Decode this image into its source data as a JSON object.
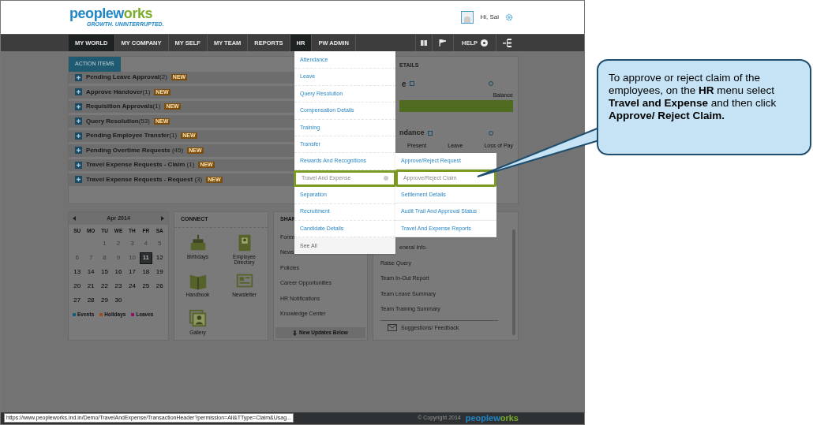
{
  "header": {
    "logo": "peopleworks",
    "tagline": "GROWTH. UNINTERRUPTED.",
    "greeting": "Hi, Sai"
  },
  "nav": {
    "items": [
      {
        "label": "MY WORLD",
        "selected": true
      },
      {
        "label": "MY COMPANY",
        "selected": false
      },
      {
        "label": "MY SELF",
        "selected": false
      },
      {
        "label": "MY TEAM",
        "selected": false
      },
      {
        "label": "REPORTS",
        "selected": false
      },
      {
        "label": "HR",
        "selected": true
      },
      {
        "label": "PW ADMIN",
        "selected": false
      }
    ],
    "help": "HELP"
  },
  "action_items": {
    "tab": "ACTION ITEMS",
    "items": [
      {
        "label": "Pending Leave Approval",
        "count": "(2)",
        "badge": "NEW"
      },
      {
        "label": "Approve Handover",
        "count": "(1)",
        "badge": "NEW"
      },
      {
        "label": "Requisition Approvals",
        "count": "(1)",
        "badge": "NEW"
      },
      {
        "label": "Query Resolution",
        "count": "(53)",
        "badge": "NEW"
      },
      {
        "label": "Pending Employee Transfer",
        "count": "(1)",
        "badge": "NEW"
      },
      {
        "label": "Pending Overtime Requests",
        "count": " (45)",
        "badge": "NEW"
      },
      {
        "label": "Travel Expense Requests - Claim",
        "count": " (1)",
        "badge": "NEW"
      },
      {
        "label": "Travel Expense Requests - Request",
        "count": " (3)",
        "badge": "NEW"
      }
    ]
  },
  "details": {
    "title": "ETAILS",
    "leave": {
      "title": "e",
      "column": "Balance"
    },
    "attendance": {
      "title": "ndance",
      "columns": [
        "Present",
        "Leave",
        "Loss of Pay"
      ]
    }
  },
  "calendar": {
    "month": "Apr 2014",
    "weekdays": [
      "SU",
      "MO",
      "TU",
      "WE",
      "TH",
      "FR",
      "SA"
    ],
    "days": [
      {
        "blank": true
      },
      {
        "blank": true
      },
      {
        "day": "1",
        "muted": true,
        "selected": false
      },
      {
        "day": "2",
        "muted": true,
        "selected": false
      },
      {
        "day": "3",
        "muted": true,
        "selected": false
      },
      {
        "day": "4",
        "muted": true,
        "selected": false
      },
      {
        "day": "5",
        "muted": true,
        "selected": false
      },
      {
        "day": "6",
        "muted": true,
        "selected": false
      },
      {
        "day": "7",
        "muted": true,
        "selected": false
      },
      {
        "day": "8",
        "muted": true,
        "selected": false
      },
      {
        "day": "9",
        "muted": true,
        "selected": false
      },
      {
        "day": "10",
        "muted": true,
        "selected": false
      },
      {
        "day": "11",
        "muted": false,
        "selected": true
      },
      {
        "day": "12",
        "muted": false,
        "selected": false
      },
      {
        "day": "13",
        "muted": false,
        "selected": false
      },
      {
        "day": "14",
        "muted": false,
        "selected": false
      },
      {
        "day": "15",
        "muted": false,
        "selected": false
      },
      {
        "day": "16",
        "muted": false,
        "selected": false
      },
      {
        "day": "17",
        "muted": false,
        "selected": false
      },
      {
        "day": "18",
        "muted": false,
        "selected": false
      },
      {
        "day": "19",
        "muted": false,
        "selected": false
      },
      {
        "day": "20",
        "muted": false,
        "selected": false
      },
      {
        "day": "21",
        "muted": false,
        "selected": false
      },
      {
        "day": "22",
        "muted": false,
        "selected": false
      },
      {
        "day": "23",
        "muted": false,
        "selected": false
      },
      {
        "day": "24",
        "muted": false,
        "selected": false
      },
      {
        "day": "25",
        "muted": false,
        "selected": false
      },
      {
        "day": "26",
        "muted": false,
        "selected": false
      },
      {
        "day": "27",
        "muted": false,
        "selected": false
      },
      {
        "day": "28",
        "muted": false,
        "selected": false
      },
      {
        "day": "29",
        "muted": false,
        "selected": false
      },
      {
        "day": "30",
        "muted": false,
        "selected": false
      }
    ],
    "legend": [
      {
        "label": "Events",
        "color": "#0f5f78"
      },
      {
        "label": "Holidays",
        "color": "#9a4e1c"
      },
      {
        "label": "Leaves",
        "color": "#8e1466"
      }
    ]
  },
  "connect": {
    "title": "CONNECT",
    "items": [
      "Birthdays",
      "Employee Directory",
      "Handbook",
      "Newsletter",
      "Gallery"
    ]
  },
  "shared": {
    "title": "SHAR",
    "links": [
      "Forms",
      "News",
      "Policies",
      "Career Opportunities",
      "HR Notifications",
      "Knowledge Center"
    ],
    "footer": "New Updates Below"
  },
  "quick_links": {
    "links": [
      "eneral Info.",
      "Raise Query",
      "Team In-Out Report",
      "Team Leave Summary",
      "Team Training Summary"
    ],
    "feedback": "Suggestions/ Feedback"
  },
  "hr_menu": {
    "items": [
      {
        "label": "Attendance",
        "highlighted": false,
        "has_submenu": false
      },
      {
        "label": "Leave",
        "highlighted": false,
        "has_submenu": false
      },
      {
        "label": "Query Resolution",
        "highlighted": false,
        "has_submenu": false
      },
      {
        "label": "Compensation Details",
        "highlighted": false,
        "has_submenu": false
      },
      {
        "label": "Training",
        "highlighted": false,
        "has_submenu": false
      },
      {
        "label": "Transfer",
        "highlighted": false,
        "has_submenu": false
      },
      {
        "label": "Rewards And Recognitions",
        "highlighted": false,
        "has_submenu": false
      },
      {
        "label": "Travel And Expense",
        "highlighted": true,
        "has_submenu": true
      },
      {
        "label": "Separation",
        "highlighted": false,
        "has_submenu": false
      },
      {
        "label": "Recruitment",
        "highlighted": false,
        "has_submenu": false
      },
      {
        "label": "Candidate Details",
        "highlighted": false,
        "has_submenu": false
      }
    ],
    "see_all": "See All",
    "submenu": [
      {
        "label": "Approve/Reject Request",
        "highlighted": false
      },
      {
        "label": "Approve/Reject Claim",
        "highlighted": true
      },
      {
        "label": "Settlement Details",
        "highlighted": false
      },
      {
        "label": "Audit Trail And Approval Status",
        "highlighted": false
      },
      {
        "label": "Travel And Expense Reports",
        "highlighted": false
      }
    ]
  },
  "status_url": "https://www.peopleworks.ind.in/Demo/TravelAndExpense/TransactionHeader?permission=All&TType=Claim&Usag...",
  "footer": {
    "copyright": "© Copyright 2014",
    "logo": "peopleworks"
  },
  "callout": "To  approve or reject claim of the employees, on the **HR** menu select **Travel and Expense** and then click **Approve/ Reject Claim.**"
}
